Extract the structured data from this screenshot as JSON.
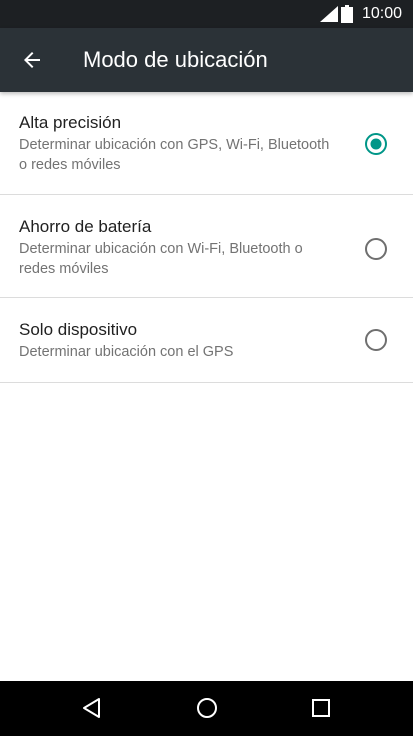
{
  "status_bar": {
    "time": "10:00",
    "icons": [
      "signal-icon",
      "battery-icon"
    ]
  },
  "toolbar": {
    "title": "Modo de ubicación",
    "back_icon": "arrow-back-icon"
  },
  "options": [
    {
      "title": "Alta precisión",
      "description": "Determinar ubicación con GPS, Wi-Fi, Bluetooth o redes móviles",
      "selected": true
    },
    {
      "title": "Ahorro de batería",
      "description": "Determinar ubicación con Wi-Fi, Bluetooth o redes móviles",
      "selected": false
    },
    {
      "title": "Solo dispositivo",
      "description": "Determinar ubicación con el GPS",
      "selected": false
    }
  ],
  "colors": {
    "accent": "#009688",
    "toolbar": "#2b3237",
    "status_bar": "#1d2023",
    "radio_off": "#6f6f6f"
  },
  "nav_bar": {
    "icons": [
      "back-triangle-icon",
      "home-circle-icon",
      "recents-square-icon"
    ]
  }
}
